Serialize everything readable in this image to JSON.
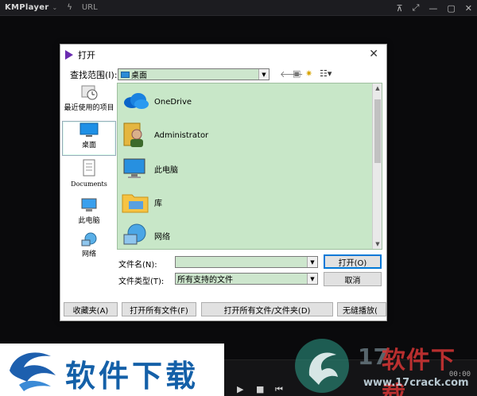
{
  "player": {
    "logo": "KMPlayer",
    "url_label": "URL",
    "time_text": "00:00"
  },
  "dialog": {
    "title": "打开",
    "look_in_label": "查找范围(I):",
    "look_in_value": "桌面",
    "places": [
      {
        "label": "最近使用的项目",
        "icon": "recent-icon"
      },
      {
        "label": "桌面",
        "icon": "desktop-icon"
      },
      {
        "label": "Documents",
        "icon": "documents-icon"
      },
      {
        "label": "此电脑",
        "icon": "computer-icon"
      },
      {
        "label": "网络",
        "icon": "network-icon"
      }
    ],
    "files": [
      {
        "name": "OneDrive",
        "icon": "onedrive-icon"
      },
      {
        "name": "Administrator",
        "icon": "user-icon"
      },
      {
        "name": "此电脑",
        "icon": "computer-icon"
      },
      {
        "name": "库",
        "icon": "library-folder-icon"
      },
      {
        "name": "网络",
        "icon": "network-icon"
      }
    ],
    "file_name_label": "文件名(N):",
    "file_name_value": "",
    "file_type_label": "文件类型(T):",
    "file_type_value": "所有支持的文件",
    "open_button": "打开(O)",
    "cancel_button": "取消",
    "bottom_buttons": [
      "收藏夹(A)",
      "打开所有文件(F)",
      "打开所有文件/文件夹(D)",
      "无缝播放("
    ]
  },
  "watermark": {
    "left_text": "软件下载",
    "right_num": "17",
    "right_text": "软件下载",
    "url": "www.17crack.com"
  }
}
